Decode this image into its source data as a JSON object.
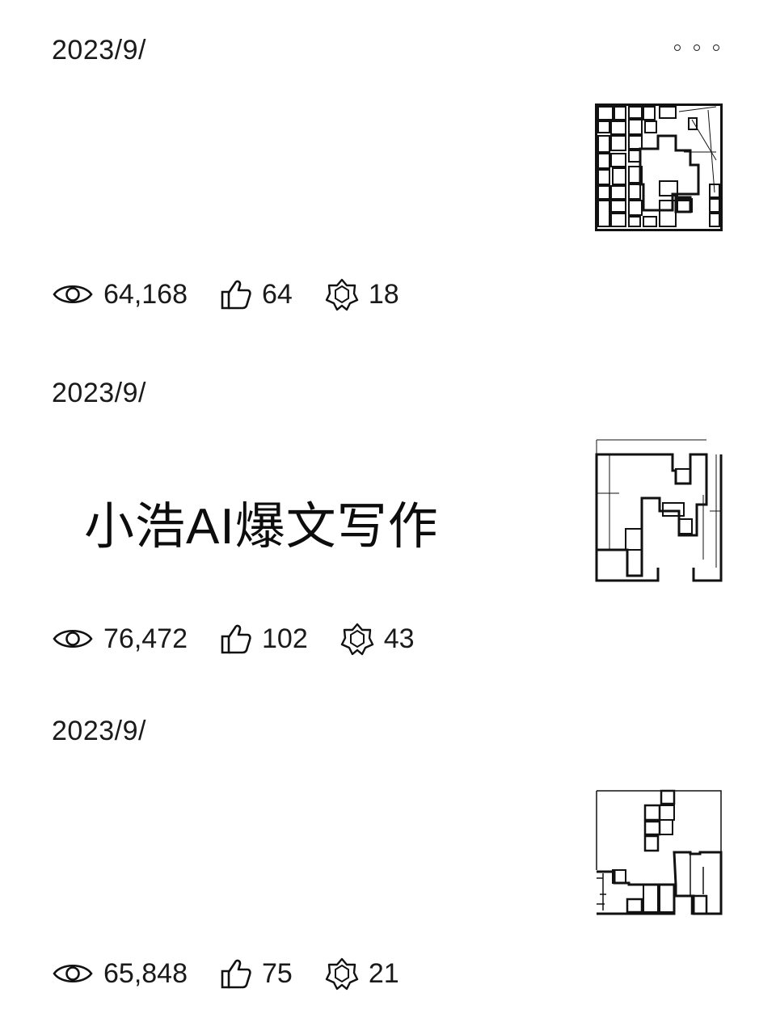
{
  "posts": [
    {
      "date": "2023/9/",
      "title": "",
      "views": "64,168",
      "likes": "64",
      "shares": "18"
    },
    {
      "date": "2023/9/",
      "title": "小浩AI爆文写作",
      "views": "76,472",
      "likes": "102",
      "shares": "43"
    },
    {
      "date": "2023/9/",
      "title": "",
      "views": "65,848",
      "likes": "75",
      "shares": "21"
    }
  ],
  "icons": {
    "more": "more-dots-icon",
    "views": "eye-icon",
    "likes": "thumbs-up-icon",
    "shares": "share-star-icon"
  }
}
